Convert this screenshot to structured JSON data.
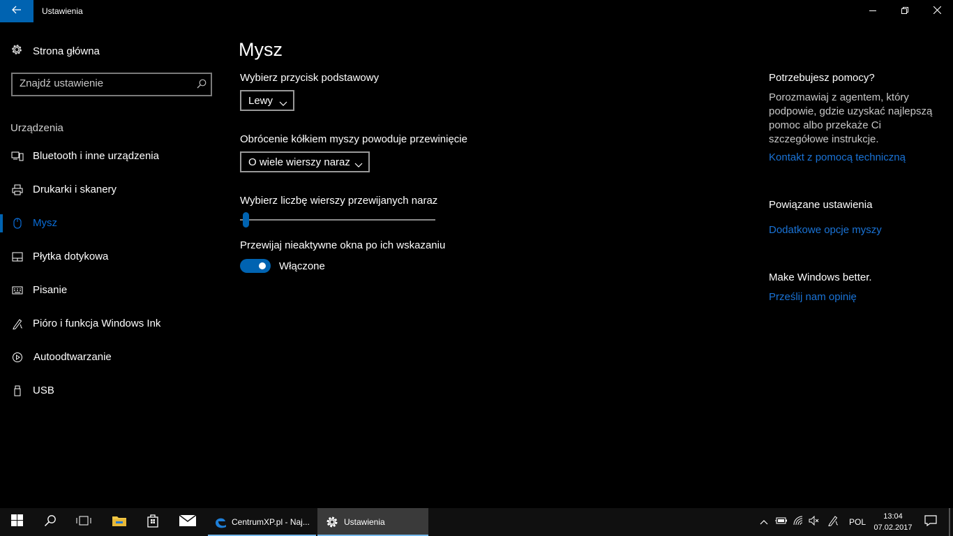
{
  "titlebar": {
    "title": "Ustawienia",
    "icons": [
      "back-arrow-icon",
      "minimize-icon",
      "restore-icon",
      "close-icon"
    ]
  },
  "sidebar": {
    "home_label": "Strona główna",
    "search_placeholder": "Znajdź ustawienie",
    "section": "Urządzenia",
    "items": [
      {
        "label": "Bluetooth i inne urządzenia",
        "icon": "bluetooth-devices-icon"
      },
      {
        "label": "Drukarki i skanery",
        "icon": "printer-icon"
      },
      {
        "label": "Mysz",
        "icon": "mouse-icon",
        "selected": true
      },
      {
        "label": "Płytka dotykowa",
        "icon": "touchpad-icon"
      },
      {
        "label": "Pisanie",
        "icon": "keyboard-icon"
      },
      {
        "label": "Pióro i funkcja Windows Ink",
        "icon": "pen-icon"
      },
      {
        "label": "Autoodtwarzanie",
        "icon": "autoplay-icon"
      },
      {
        "label": "USB",
        "icon": "usb-icon"
      }
    ]
  },
  "main": {
    "title": "Mysz",
    "primary_button_label": "Wybierz przycisk podstawowy",
    "primary_button_value": "Lewy",
    "scroll_label": "Obrócenie kółkiem myszy powoduje przewinięcie",
    "scroll_value": "O wiele wierszy naraz",
    "lines_label": "Wybierz liczbę wierszy przewijanych naraz",
    "lines_slider_value_fraction": 0.02,
    "inactive_label": "Przewijaj nieaktywne okna po ich wskazaniu",
    "inactive_state": "Włączone",
    "inactive_on": true
  },
  "help": {
    "title": "Potrzebujesz pomocy?",
    "text": "Porozmawiaj z agentem, który podpowie, gdzie uzyskać najlepszą pomoc albo przekaże Ci szczegółowe instrukcje.",
    "link": "Kontakt z pomocą techniczną",
    "related_title": "Powiązane ustawienia",
    "related_link": "Dodatkowe opcje myszy",
    "feedback_title": "Make Windows better.",
    "feedback_link": "Prześlij nam opinię"
  },
  "taskbar": {
    "apps": [
      {
        "label": "CentrumXP.pl - Naj...",
        "icon": "edge-icon"
      },
      {
        "label": "Ustawienia",
        "icon": "settings-icon",
        "active": true
      }
    ],
    "language": "POL",
    "time": "13:04",
    "date": "07.02.2017"
  },
  "colors": {
    "accent": "#0063b1",
    "link": "#1a73d6",
    "background": "#000000"
  }
}
